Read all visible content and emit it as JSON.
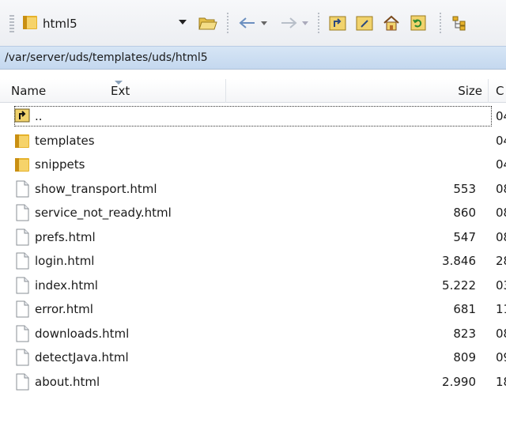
{
  "toolbar": {
    "location_combo": "html5"
  },
  "path": "/var/server/uds/templates/uds/html5",
  "columns": {
    "name": "Name",
    "ext": "Ext",
    "size": "Size",
    "changed": "C"
  },
  "files": [
    {
      "name": "..",
      "type": "parent",
      "size": "",
      "changed": "04"
    },
    {
      "name": "templates",
      "type": "folder",
      "size": "",
      "changed": "04"
    },
    {
      "name": "snippets",
      "type": "folder",
      "size": "",
      "changed": "04"
    },
    {
      "name": "show_transport.html",
      "type": "file",
      "size": "553",
      "changed": "08"
    },
    {
      "name": "service_not_ready.html",
      "type": "file",
      "size": "860",
      "changed": "08"
    },
    {
      "name": "prefs.html",
      "type": "file",
      "size": "547",
      "changed": "08"
    },
    {
      "name": "login.html",
      "type": "file",
      "size": "3.846",
      "changed": "28"
    },
    {
      "name": "index.html",
      "type": "file",
      "size": "5.222",
      "changed": "03"
    },
    {
      "name": "error.html",
      "type": "file",
      "size": "681",
      "changed": "11"
    },
    {
      "name": "downloads.html",
      "type": "file",
      "size": "823",
      "changed": "08"
    },
    {
      "name": "detectJava.html",
      "type": "file",
      "size": "809",
      "changed": "09"
    },
    {
      "name": "about.html",
      "type": "file",
      "size": "2.990",
      "changed": "18"
    }
  ],
  "icons": {
    "combo": "folder-icon",
    "open": "open-folder-icon",
    "back": "back-arrow-icon",
    "forward": "forward-arrow-icon",
    "parent": "parent-directory-icon",
    "root": "root-directory-icon",
    "home": "home-icon",
    "refresh": "refresh-icon",
    "tree": "directory-tree-icon"
  },
  "colors": {
    "pathbar": "#c9dcf1",
    "folder": "#e8b930"
  }
}
